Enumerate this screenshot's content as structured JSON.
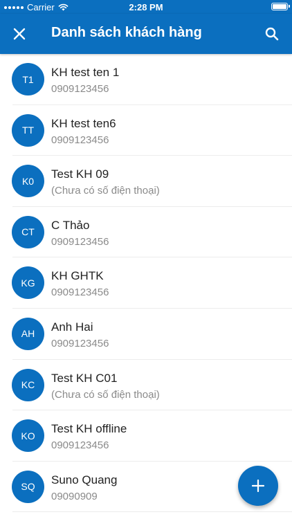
{
  "status_bar": {
    "carrier": "Carrier",
    "time": "2:28 PM",
    "icons": [
      "signal-icon",
      "wifi-icon",
      "battery-icon"
    ]
  },
  "app_bar": {
    "title": "Danh sách khách hàng",
    "close_icon": "close-icon",
    "search_icon": "search-icon"
  },
  "colors": {
    "primary": "#0b6fbf",
    "text": "#222222",
    "subtext": "#8a8a8a",
    "divider": "#ececec"
  },
  "customers": [
    {
      "initials": "T1",
      "name": "KH test ten 1",
      "phone": "0909123456"
    },
    {
      "initials": "TT",
      "name": "KH test ten6",
      "phone": "0909123456"
    },
    {
      "initials": "K0",
      "name": "Test KH 09",
      "phone": "(Chưa có số điện thoại)"
    },
    {
      "initials": "CT",
      "name": "C Thảo",
      "phone": "0909123456"
    },
    {
      "initials": "KG",
      "name": "KH GHTK",
      "phone": "0909123456"
    },
    {
      "initials": "AH",
      "name": "Anh Hai",
      "phone": "0909123456"
    },
    {
      "initials": "KC",
      "name": "Test KH C01",
      "phone": "(Chưa có số điện thoại)"
    },
    {
      "initials": "KO",
      "name": "Test KH offline",
      "phone": "0909123456"
    },
    {
      "initials": "SQ",
      "name": "Suno Quang",
      "phone": "09090909"
    }
  ],
  "fab": {
    "icon": "plus-icon"
  }
}
